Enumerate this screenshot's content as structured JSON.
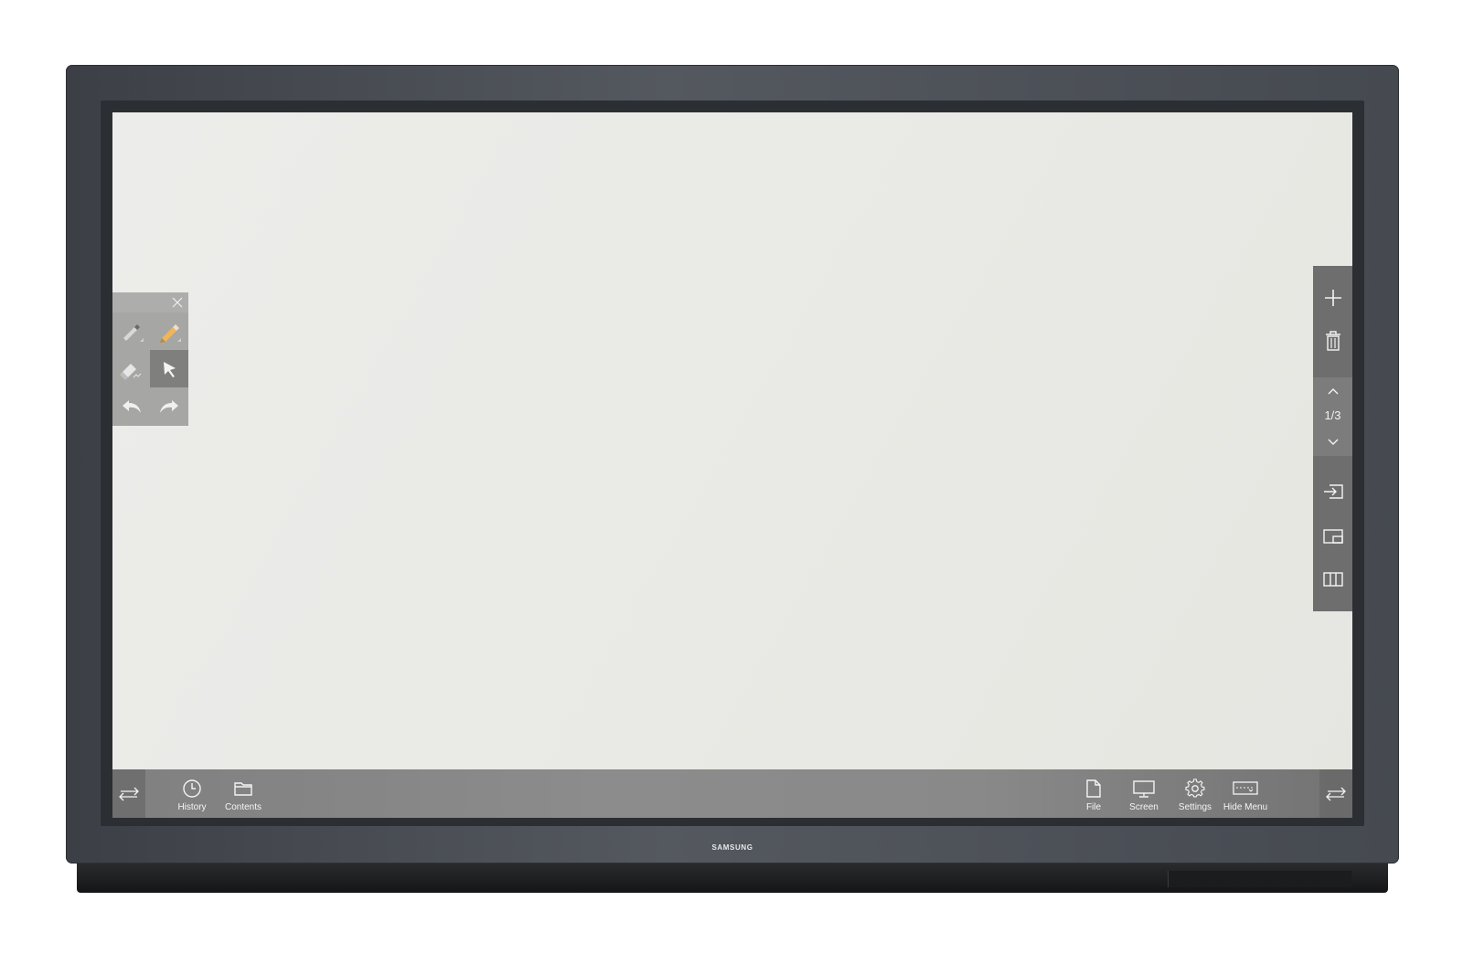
{
  "device": {
    "brand": "SAMSUNG"
  },
  "toolbox": {
    "tools": [
      {
        "name": "pen-icon",
        "active": false
      },
      {
        "name": "highlighter-icon",
        "active": false
      },
      {
        "name": "eraser-icon",
        "active": false
      },
      {
        "name": "select-pointer-icon",
        "active": true
      },
      {
        "name": "undo-icon",
        "active": false
      },
      {
        "name": "redo-icon",
        "active": false
      }
    ],
    "close_icon": "close-icon"
  },
  "right_panel": {
    "add_icon": "plus-icon",
    "delete_icon": "trash-icon",
    "page_up_icon": "chevron-up-icon",
    "page_indicator": "1/3",
    "page_down_icon": "chevron-down-icon",
    "input_icon": "input-source-icon",
    "pip_icon": "picture-in-picture-icon",
    "layout_icon": "split-layout-icon"
  },
  "bottom_bar": {
    "left_items": [
      {
        "label": "History",
        "icon": "clock-icon"
      },
      {
        "label": "Contents",
        "icon": "folder-icon"
      }
    ],
    "right_items": [
      {
        "label": "File",
        "icon": "file-icon"
      },
      {
        "label": "Screen",
        "icon": "monitor-icon"
      },
      {
        "label": "Settings",
        "icon": "gear-icon"
      },
      {
        "label": "Hide Menu",
        "icon": "hide-menu-icon"
      }
    ],
    "swap_icon": "swap-arrows-icon"
  },
  "colors": {
    "bezel": "#4a4e55",
    "screen": "#e9e9e5",
    "menu_bar": "#888888"
  }
}
